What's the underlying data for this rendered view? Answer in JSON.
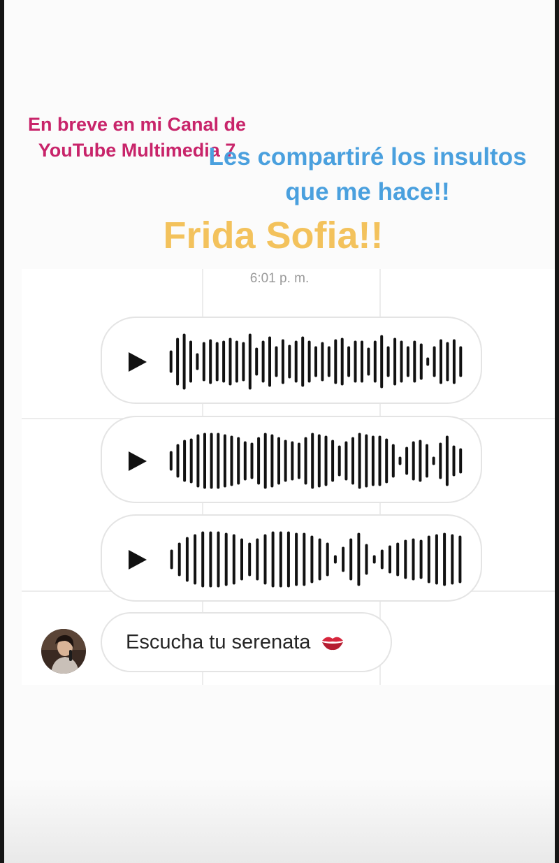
{
  "story": {
    "caption_pink": "En breve en mi Canal de YouTube Multimedia 7",
    "caption_blue": "Les compartiré los insultos que me hace!!",
    "caption_gold": "Frida Sofia!!"
  },
  "chat": {
    "timestamp": "6:01 p. m.",
    "voice_messages": [
      {
        "icon": "play-icon",
        "waveform_levels": [
          0.4,
          0.85,
          1,
          0.75,
          0.3,
          0.7,
          0.8,
          0.7,
          0.75,
          0.85,
          0.75,
          0.7,
          1,
          0.5,
          0.75,
          0.9,
          0.55,
          0.8,
          0.6,
          0.75,
          0.9,
          0.75,
          0.55,
          0.7,
          0.55,
          0.8,
          0.85,
          0.55,
          0.75,
          0.75,
          0.5,
          0.75,
          0.95,
          0.55,
          0.85,
          0.75,
          0.55,
          0.75,
          0.65,
          0.15,
          0.55,
          0.8,
          0.7,
          0.8,
          0.55
        ]
      },
      {
        "icon": "play-icon",
        "waveform_levels": [
          0.35,
          0.6,
          0.75,
          0.8,
          0.95,
          1,
          1,
          1,
          0.95,
          0.9,
          0.85,
          0.7,
          0.65,
          0.85,
          1,
          0.95,
          0.85,
          0.75,
          0.7,
          0.65,
          0.85,
          1,
          0.95,
          0.9,
          0.75,
          0.55,
          0.7,
          0.85,
          1,
          0.95,
          0.9,
          0.9,
          0.8,
          0.6,
          0.15,
          0.5,
          0.7,
          0.75,
          0.6,
          0.15,
          0.65,
          0.9,
          0.55,
          0.45
        ]
      },
      {
        "icon": "play-icon",
        "waveform_levels": [
          0.35,
          0.6,
          0.8,
          0.9,
          1,
          1,
          1,
          0.95,
          0.9,
          0.75,
          0.6,
          0.75,
          0.9,
          1,
          1,
          1,
          0.95,
          0.95,
          0.85,
          0.75,
          0.6,
          0.15,
          0.45,
          0.75,
          0.95,
          0.55,
          0.15,
          0.35,
          0.5,
          0.6,
          0.7,
          0.75,
          0.7,
          0.85,
          0.9,
          0.95,
          0.9,
          0.85
        ]
      }
    ],
    "text_message": {
      "text": "Escucha tu serenata",
      "emoji_icon": "kiss-mark-icon"
    },
    "avatar_icon": "profile-avatar"
  },
  "colors": {
    "pink": "#c8246a",
    "blue": "#4aa0de",
    "gold": "#f3c25c",
    "waveform": "#111111"
  }
}
